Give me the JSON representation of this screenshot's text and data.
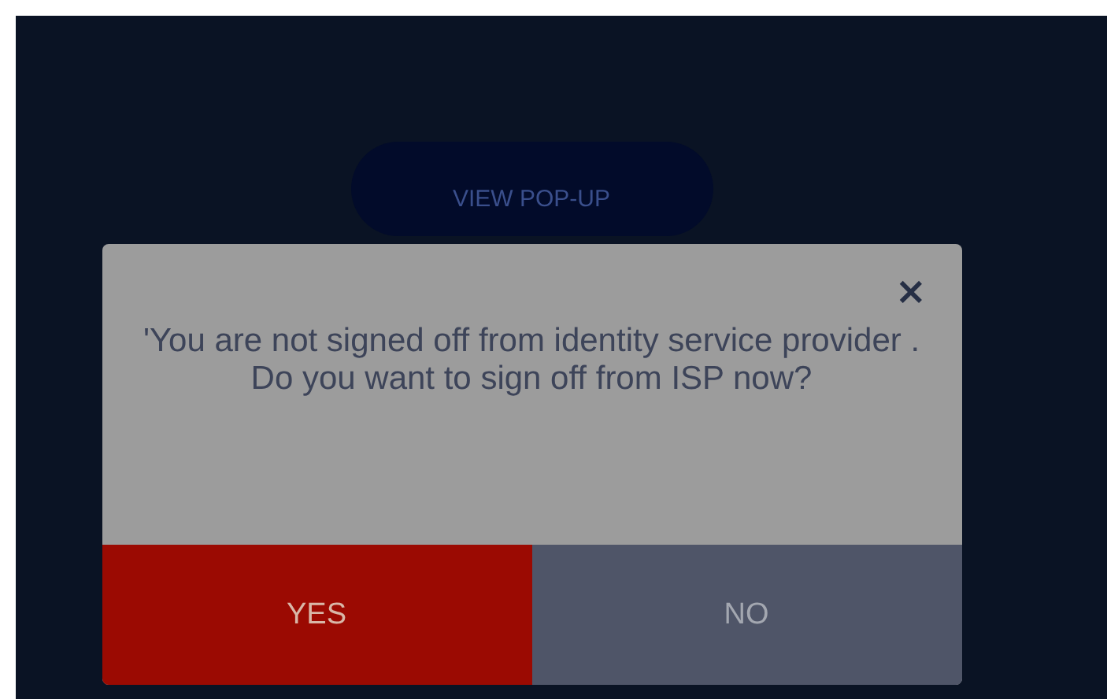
{
  "page_button": {
    "label": "VIEW POP-UP"
  },
  "dialog": {
    "close": "×",
    "message": "'You are not signed off from identity service provider . Do you want to sign off from ISP now?",
    "buttons": [
      {
        "label": "YES",
        "kind": "confirm"
      },
      {
        "label": "NO",
        "kind": "cancel"
      }
    ]
  }
}
